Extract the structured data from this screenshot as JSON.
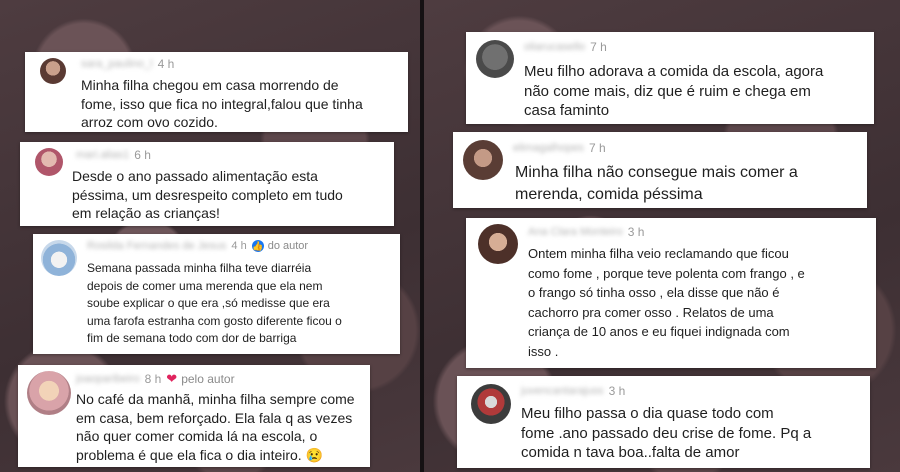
{
  "left_comments": [
    {
      "author": "sara_paulino_l",
      "time": "4 h",
      "text": "Minha filha chegou em casa morrendo de\nfome, isso que fica no integral,falou que tinha\narroz com ovo cozido."
    },
    {
      "author": "mari.alias1",
      "time": "6 h",
      "text": "Desde o ano passado alimentação esta\npéssima, um desrespeito completo em tudo\nem relação as crianças!"
    },
    {
      "author": "Rosilda Fernandes de Jesus",
      "time": "4 h",
      "tag": "do autor",
      "text": "Semana passada minha filha teve diarréia\ndepois de comer uma merenda que ela nem\nsoube explicar o que era ,só medisse que era\numa farofa estranha com gosto diferente ficou o\nfim de semana todo com dor de barriga"
    },
    {
      "author": "joaoparibeiro",
      "time": "8 h",
      "tag": "pelo autor",
      "text": "No café da manhã, minha filha sempre come\nem casa, bem reforçado. Ela fala q as vezes\nnão quer comer comida lá na escola, o\nproblema é que ela fica o dia inteiro. 😢"
    }
  ],
  "right_comments": [
    {
      "author": "oliarucasello",
      "time": "7 h",
      "text": "Meu filho adorava a comida da escola, agora\nnão come mais, diz que é ruim e chega em\ncasa faminto"
    },
    {
      "author": "elimagalhopes",
      "time": "7 h",
      "text": "Minha filha não consegue mais comer a\nmerenda, comida péssima"
    },
    {
      "author": "Ana Clara Monteiro",
      "time": "3 h",
      "text": "Ontem minha filha veio reclamando que ficou\ncomo fome , porque teve polenta com frango , e\no frango só tinha osso , ela disse que não é\ncachorro pra comer osso . Relatos de uma\ncriança de 10 anos e eu fiquei indignada com\nisso ."
    },
    {
      "author": "juvencantarajuss",
      "time": "3 h",
      "text": "Meu filho passa o dia quase todo com\nfome .ano passado deu crise de fome. Pq a\ncomida n tava boa..falta de amor"
    }
  ],
  "colors": {
    "verified_badge": "#1877f2",
    "heart": "#e0245e"
  }
}
